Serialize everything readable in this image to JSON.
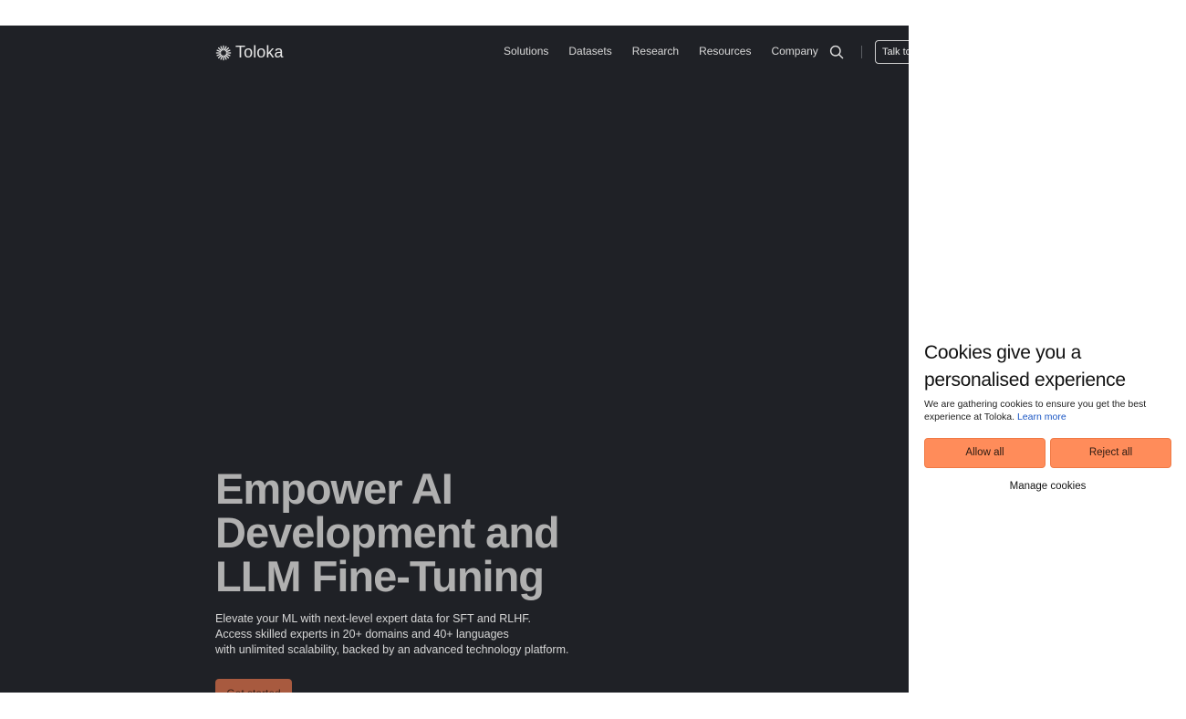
{
  "nav": {
    "logo_text": "Toloka",
    "links": [
      "Solutions",
      "Datasets",
      "Research",
      "Resources",
      "Company"
    ],
    "talk_label": "Talk to"
  },
  "hero": {
    "title_lines": [
      "Empower AI",
      "Development and",
      "LLM Fine-Tuning"
    ],
    "subtitle_lines": [
      "Elevate your ML with next-level expert data for SFT and RLHF.",
      "Access skilled experts in 20+ domains and 40+ languages",
      "with unlimited scalability, backed by an advanced technology platform."
    ],
    "cta_label": "Get started"
  },
  "cookie_banner": {
    "title": "Cookies give you a personalised experience",
    "text": "We are gathering cookies to ensure you get the best experience at Toloka.",
    "learn_more": "Learn more",
    "allow_label": "Allow all",
    "reject_label": "Reject all",
    "manage_label": "Manage cookies"
  },
  "colors": {
    "page_bg": "#1f2126",
    "cta_bg": "#a85a3f",
    "cookie_button_bg": "#ff8c5a",
    "link": "#1a56c4"
  }
}
